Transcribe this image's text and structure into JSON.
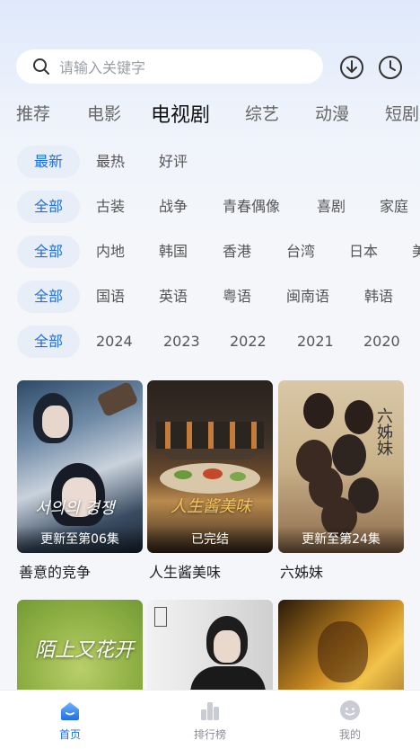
{
  "search": {
    "placeholder": "请输入关键字"
  },
  "header_icons": [
    "download-icon",
    "history-clock-icon"
  ],
  "tabs": [
    {
      "label": "推荐"
    },
    {
      "label": "电影"
    },
    {
      "label": "电视剧",
      "active": true
    },
    {
      "label": "综艺"
    },
    {
      "label": "动漫"
    },
    {
      "label": "短剧"
    }
  ],
  "filters": {
    "sort": [
      "最新",
      "最热",
      "好评"
    ],
    "genre": [
      "全部",
      "古装",
      "战争",
      "青春偶像",
      "喜剧",
      "家庭"
    ],
    "region": [
      "全部",
      "内地",
      "韩国",
      "香港",
      "台湾",
      "日本",
      "美"
    ],
    "language": [
      "全部",
      "国语",
      "英语",
      "粤语",
      "闽南语",
      "韩语"
    ],
    "year": [
      "全部",
      "2024",
      "2023",
      "2022",
      "2021",
      "2020"
    ]
  },
  "cards": [
    {
      "name": "善意的竞争",
      "episode": "更新至第06集",
      "poster_text": "서의의 경쟁"
    },
    {
      "name": "人生酱美味",
      "episode": "已完结",
      "poster_text": "人生酱美味"
    },
    {
      "name": "六姊妹",
      "episode": "更新至第24集",
      "poster_text": "六姊妹"
    },
    {
      "name": "",
      "episode": "",
      "poster_text": "陌上又花开"
    },
    {
      "name": "",
      "episode": "",
      "poster_text": ""
    },
    {
      "name": "",
      "episode": "",
      "poster_text": ""
    }
  ],
  "bottom_nav": [
    {
      "label": "首页",
      "icon": "home-icon",
      "active": true
    },
    {
      "label": "排行榜",
      "icon": "ranking-icon"
    },
    {
      "label": "我的",
      "icon": "profile-icon"
    }
  ],
  "colors": {
    "accent": "#1e6fe8",
    "chip_bg": "#e8eef8"
  }
}
